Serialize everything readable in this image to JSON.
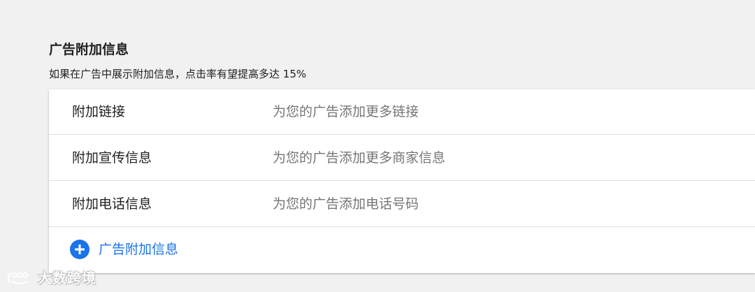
{
  "section": {
    "title": "广告附加信息",
    "subtitle": "如果在广告中展示附加信息，点击率有望提高多达 15%"
  },
  "extensions": [
    {
      "label": "附加链接",
      "description": "为您的广告添加更多链接"
    },
    {
      "label": "附加宣传信息",
      "description": "为您的广告添加更多商家信息"
    },
    {
      "label": "附加电话信息",
      "description": "为您的广告添加电话号码"
    }
  ],
  "add_extension": {
    "label": "广告附加信息",
    "icon": "add-circle-icon"
  },
  "watermark": {
    "text": "大数跨境"
  },
  "colors": {
    "background": "#f1f1f1",
    "card": "#ffffff",
    "accent": "#1a73e8",
    "primary_text": "#212121",
    "secondary_text": "#757575"
  }
}
